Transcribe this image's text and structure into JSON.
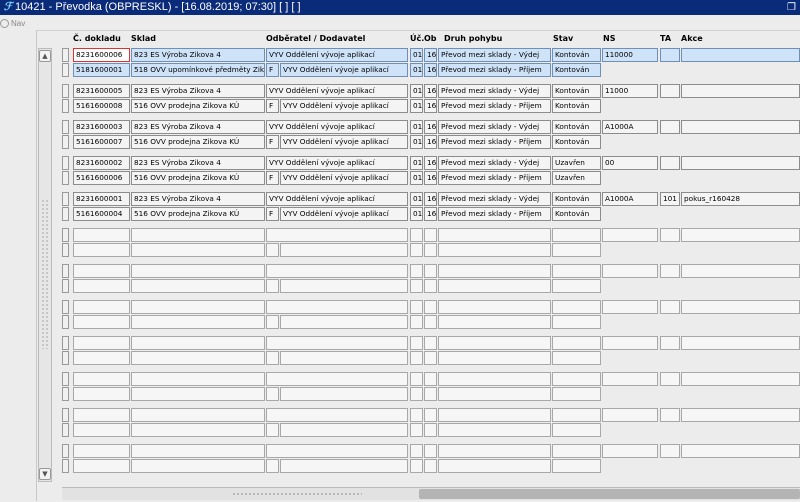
{
  "window": {
    "title": "10421 - Převodka (OBPRESKL) - [16.08.2019; 07:30]  [ ]  [ ]"
  },
  "nav": {
    "label": "Nav"
  },
  "columns": {
    "doc": "Č. dokladu",
    "sklad": "Sklad",
    "odber": "Odběratel / Dodavatel",
    "uc": "Úč.",
    "ob": "Ob",
    "druh": "Druh pohybu",
    "stav": "Stav",
    "ns": "NS",
    "ta": "TA",
    "akce": "Akce"
  },
  "groups": [
    {
      "rows": [
        {
          "doc": "8231600006",
          "sklad": "823 ES Výroba Zikova 4",
          "f": "",
          "odber": "VYV Oddělení vývoje aplikací",
          "uc": "01",
          "ob": "16",
          "druh": "Převod mezi sklady - Výdej",
          "stav": "Kontován",
          "ns": "110000",
          "ta": "",
          "akce": ""
        },
        {
          "doc": "5181600001",
          "sklad": "518 OVV upomínkové předměty Zikova 4",
          "f": "F",
          "odber": "VYV Oddělení vývoje aplikací",
          "uc": "01",
          "ob": "16",
          "druh": "Převod mezi sklady - Příjem",
          "stav": "Kontován"
        }
      ]
    },
    {
      "rows": [
        {
          "doc": "8231600005",
          "sklad": "823 ES Výroba Zikova 4",
          "f": "",
          "odber": "VYV Oddělení vývoje aplikací",
          "uc": "01",
          "ob": "16",
          "druh": "Převod mezi sklady - Výdej",
          "stav": "Kontován",
          "ns": "11000",
          "ta": "",
          "akce": ""
        },
        {
          "doc": "5161600008",
          "sklad": "516 OVV prodejna Zikova KÚ",
          "f": "F",
          "odber": "VYV Oddělení vývoje aplikací",
          "uc": "01",
          "ob": "16",
          "druh": "Převod mezi sklady - Příjem",
          "stav": "Kontován"
        }
      ]
    },
    {
      "rows": [
        {
          "doc": "8231600003",
          "sklad": "823 ES Výroba Zikova 4",
          "f": "",
          "odber": "VYV Oddělení vývoje aplikací",
          "uc": "01",
          "ob": "16",
          "druh": "Převod mezi sklady - Výdej",
          "stav": "Kontován",
          "ns": "A1000A",
          "ta": "",
          "akce": ""
        },
        {
          "doc": "5161600007",
          "sklad": "516 OVV prodejna Zikova KÚ",
          "f": "F",
          "odber": "VYV Oddělení vývoje aplikací",
          "uc": "01",
          "ob": "16",
          "druh": "Převod mezi sklady - Příjem",
          "stav": "Kontován"
        }
      ]
    },
    {
      "rows": [
        {
          "doc": "8231600002",
          "sklad": "823 ES Výroba Zikova 4",
          "f": "",
          "odber": "VYV Oddělení vývoje aplikací",
          "uc": "01",
          "ob": "16",
          "druh": "Převod mezi sklady - Výdej",
          "stav": "Uzavřen",
          "ns": "00",
          "ta": "",
          "akce": ""
        },
        {
          "doc": "5161600006",
          "sklad": "516 OVV prodejna Zikova KÚ",
          "f": "F",
          "odber": "VYV Oddělení vývoje aplikací",
          "uc": "01",
          "ob": "16",
          "druh": "Převod mezi sklady - Příjem",
          "stav": "Uzavřen"
        }
      ]
    },
    {
      "rows": [
        {
          "doc": "8231600001",
          "sklad": "823 ES Výroba Zikova 4",
          "f": "",
          "odber": "VYV Oddělení vývoje aplikací",
          "uc": "01",
          "ob": "16",
          "druh": "Převod mezi sklady - Výdej",
          "stav": "Kontován",
          "ns": "A1000A",
          "ta": "101",
          "akce": "pokus_r160428"
        },
        {
          "doc": "5161600004",
          "sklad": "516 OVV prodejna Zikova KÚ",
          "f": "F",
          "odber": "VYV Oddělení vývoje aplikací",
          "uc": "01",
          "ob": "16",
          "druh": "Převod mezi sklady - Příjem",
          "stav": "Kontován"
        }
      ]
    }
  ],
  "empty_group_count": 7,
  "icons": {
    "app": "app-logo-icon",
    "nav": "nav-icon",
    "restore": "restore-window-icon",
    "scroll_up": "arrow-up-icon",
    "scroll_down": "arrow-down-icon"
  },
  "colors": {
    "titlebar": "#0a2a7a",
    "selected_row": "#cfe3f8",
    "focus_border": "#dd3333"
  }
}
